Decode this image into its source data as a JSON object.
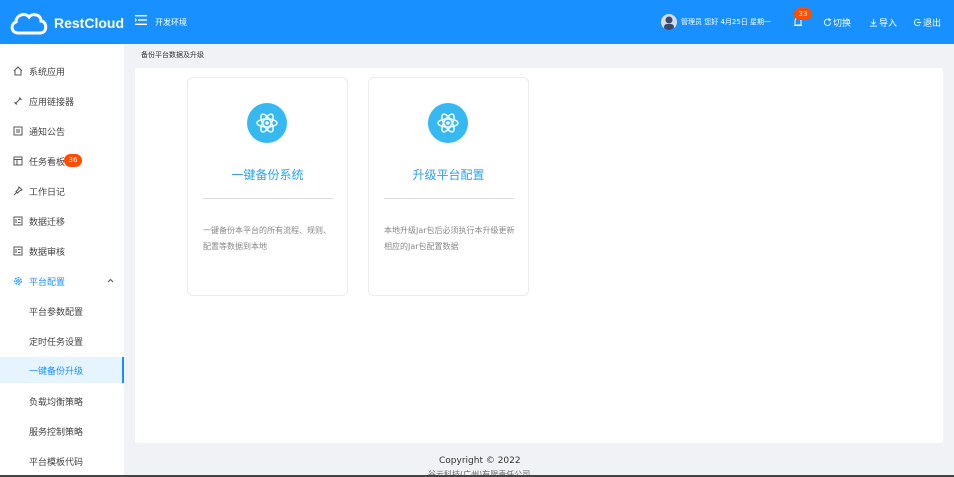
{
  "header": {
    "logo_text": "RestCloud",
    "env_label": "开发环境",
    "user_text": "管理员 您好 4月25日 星期一",
    "bell_count": "33",
    "switch_label": "切换",
    "import_label": "导入",
    "logout_label": "退出"
  },
  "sidebar": {
    "items": [
      {
        "label": "系统应用",
        "icon": "home-icon"
      },
      {
        "label": "应用链接器",
        "icon": "link-icon"
      },
      {
        "label": "通知公告",
        "icon": "notice-icon"
      },
      {
        "label": "任务看板",
        "icon": "board-icon",
        "badge": "36"
      },
      {
        "label": "工作日记",
        "icon": "pin-icon"
      },
      {
        "label": "数据迁移",
        "icon": "list-icon"
      },
      {
        "label": "数据审核",
        "icon": "list-icon"
      },
      {
        "label": "平台配置",
        "icon": "gear-icon",
        "expanded": true
      }
    ],
    "subitems": [
      {
        "label": "平台参数配置"
      },
      {
        "label": "定时任务设置"
      },
      {
        "label": "一键备份升级",
        "selected": true
      },
      {
        "label": "负载均衡策略"
      },
      {
        "label": "服务控制策略"
      },
      {
        "label": "平台模板代码"
      }
    ]
  },
  "breadcrumb": "备份平台数据及升级",
  "cards": [
    {
      "title": "一键备份系统",
      "desc": "一键备份本平台的所有流程、规则、配置等数据到本地"
    },
    {
      "title": "升级平台配置",
      "desc": "本地升级Jar包后必须执行本升级更新相应的Jar包配置数据"
    }
  ],
  "footer": {
    "copyright": "Copyright © 2022",
    "company": "谷云科技(广州)有限责任公司"
  },
  "colors": {
    "primary": "#1890ff",
    "badge": "#ff4d00",
    "card_icon": "#36b8f0",
    "card_title": "#2aa4e9"
  }
}
